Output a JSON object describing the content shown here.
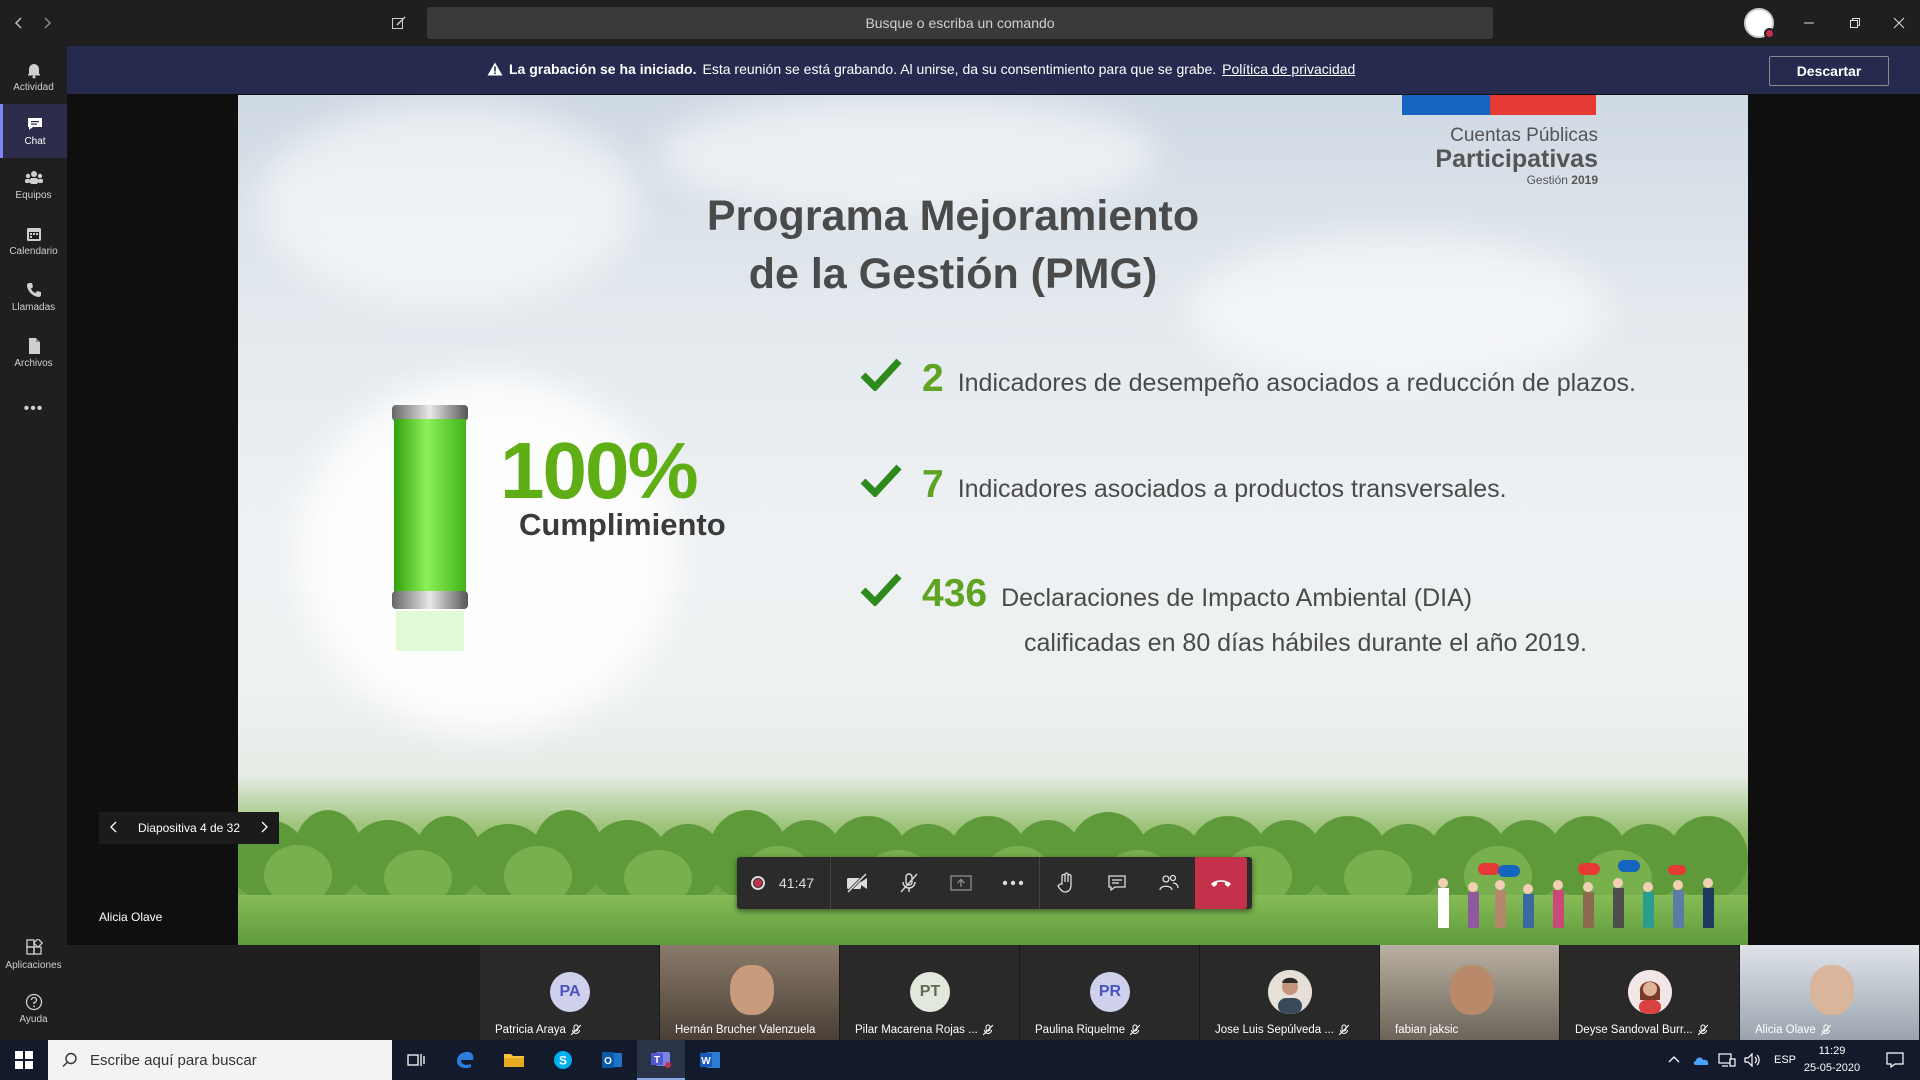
{
  "titlebar": {
    "search_placeholder": "Busque o escriba un comando"
  },
  "rail": {
    "items": [
      {
        "label": "Actividad",
        "icon": "bell-icon"
      },
      {
        "label": "Chat",
        "icon": "chat-icon"
      },
      {
        "label": "Equipos",
        "icon": "teams-icon"
      },
      {
        "label": "Calendario",
        "icon": "calendar-icon"
      },
      {
        "label": "Llamadas",
        "icon": "phone-icon"
      },
      {
        "label": "Archivos",
        "icon": "file-icon"
      }
    ],
    "more": "•••",
    "bottom": [
      {
        "label": "Aplicaciones",
        "icon": "apps-icon"
      },
      {
        "label": "Ayuda",
        "icon": "help-icon"
      }
    ]
  },
  "banner": {
    "bold": "La grabación se ha iniciado.",
    "text": "Esta reunión se está grabando. Al unirse, da su consentimiento para que se grabe.",
    "link": "Política de privacidad",
    "dismiss": "Descartar"
  },
  "slide": {
    "brand_line1": "Cuentas Públicas",
    "brand_line2": "Participativas",
    "brand_line3_prefix": "Gestión",
    "brand_line3_year": "2019",
    "title_line1": "Programa Mejoramiento",
    "title_line2": "de la Gestión (PMG)",
    "percent": "100%",
    "percent_label": "Cumplimiento",
    "bullets": [
      {
        "num": "2",
        "text": "Indicadores de desempeño asociados a reducción de plazos."
      },
      {
        "num": "7",
        "text": "Indicadores asociados a productos transversales."
      },
      {
        "num": "436",
        "text": "Declaraciones de Impacto Ambiental (DIA)",
        "text2": "calificadas en 80 días hábiles durante el año 2019."
      }
    ]
  },
  "slidenav": {
    "label": "Diapositiva 4 de 32"
  },
  "presenter": "Alicia Olave",
  "controls": {
    "timer": "41:47"
  },
  "participants": [
    {
      "initials": "PA",
      "name": "Patricia Araya",
      "type": "avatar"
    },
    {
      "initials": "",
      "name": "Hernán Brucher Valenzuela",
      "type": "video"
    },
    {
      "initials": "PT",
      "name": "Pilar Macarena Rojas ...",
      "type": "avatar"
    },
    {
      "initials": "PR",
      "name": "Paulina Riquelme",
      "type": "avatar"
    },
    {
      "initials": "",
      "name": "Jose Luis Sepúlveda ...",
      "type": "photo"
    },
    {
      "initials": "",
      "name": "fabian jaksic",
      "type": "video2"
    },
    {
      "initials": "",
      "name": "Deyse Sandoval Burr...",
      "type": "photo"
    },
    {
      "initials": "",
      "name": "Alicia Olave",
      "type": "video3"
    }
  ],
  "taskbar": {
    "search_placeholder": "Escribe aquí para buscar",
    "lang": "ESP",
    "time": "11:29",
    "date": "25-05-2020"
  },
  "colors": {
    "accent": "#7f85f5",
    "banner_bg": "#262a4e",
    "hangup": "#c4314b",
    "green_text": "#5fae15"
  }
}
